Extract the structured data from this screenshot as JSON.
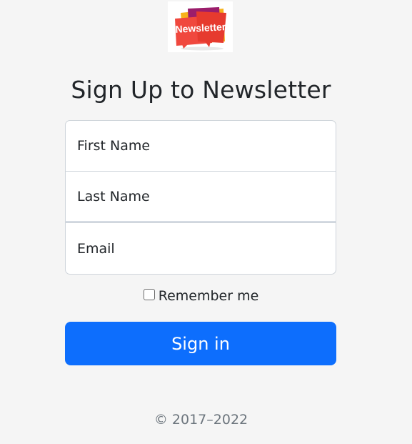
{
  "logo": {
    "text": "Newsletter",
    "colors": [
      "#f7b21a",
      "#e63a2e",
      "#9b1d6b",
      "#f0483e"
    ]
  },
  "heading": "Sign Up to Newsletter",
  "form": {
    "first_name_placeholder": "First Name",
    "last_name_placeholder": "Last Name",
    "email_placeholder": "Email",
    "remember_label": "Remember me",
    "remember_checked": false,
    "submit_label": "Sign in",
    "accent_color": "#0d6efd"
  },
  "footer": {
    "text": "© 2017–2022"
  }
}
